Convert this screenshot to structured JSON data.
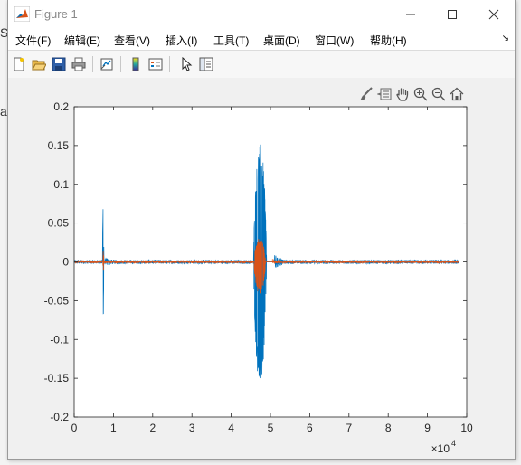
{
  "window": {
    "title": "Figure 1"
  },
  "background": {
    "letters": [
      "S",
      "a"
    ]
  },
  "menu": {
    "items": [
      "文件(F)",
      "编辑(E)",
      "查看(V)",
      "插入(I)",
      "工具(T)",
      "桌面(D)",
      "窗口(W)",
      "帮助(H)"
    ]
  },
  "toolbar": {
    "icons": [
      "new-figure-icon",
      "open-file-icon",
      "save-icon",
      "print-icon",
      "link-plot-icon",
      "colorbar-icon",
      "legend-icon",
      "pointer-icon",
      "property-editor-icon"
    ]
  },
  "axes_toolbar": {
    "icons": [
      "brush-icon",
      "data-tips-icon",
      "pan-hand-icon",
      "zoom-in-icon",
      "zoom-out-icon",
      "home-icon"
    ]
  },
  "chart_data": {
    "type": "line",
    "title": "",
    "xlabel": "",
    "ylabel": "",
    "xlim": [
      0,
      10
    ],
    "ylim": [
      -0.2,
      0.2
    ],
    "x_exponent_label": "×10",
    "x_exponent": "4",
    "x_ticks": [
      "0",
      "1",
      "2",
      "3",
      "4",
      "5",
      "6",
      "7",
      "8",
      "9",
      "10"
    ],
    "y_ticks": [
      "0.2",
      "0.15",
      "0.1",
      "0.05",
      "0",
      "-0.05",
      "-0.1",
      "-0.15",
      "-0.2"
    ],
    "y_tick_values": [
      0.2,
      0.15,
      0.1,
      0.05,
      0,
      -0.05,
      -0.1,
      -0.15,
      -0.2
    ],
    "grid": false,
    "series": [
      {
        "color": "#0072bd",
        "x_start": 0,
        "x_end": 9.8,
        "baseline_amp": 0.0025,
        "bursts": [
          {
            "start": 0.72,
            "end": 0.78,
            "peak": 0.082,
            "trough": -0.072
          },
          {
            "start": 4.57,
            "end": 5.1,
            "peak": 0.153,
            "trough": -0.162
          }
        ]
      },
      {
        "color": "#d95319",
        "x_start": 0,
        "x_end": 9.8,
        "baseline_amp": 0.0015,
        "bursts": [
          {
            "start": 0.73,
            "end": 0.77,
            "peak": 0.018,
            "trough": -0.012
          },
          {
            "start": 4.58,
            "end": 5.05,
            "peak": 0.031,
            "trough": -0.043
          }
        ]
      }
    ]
  }
}
